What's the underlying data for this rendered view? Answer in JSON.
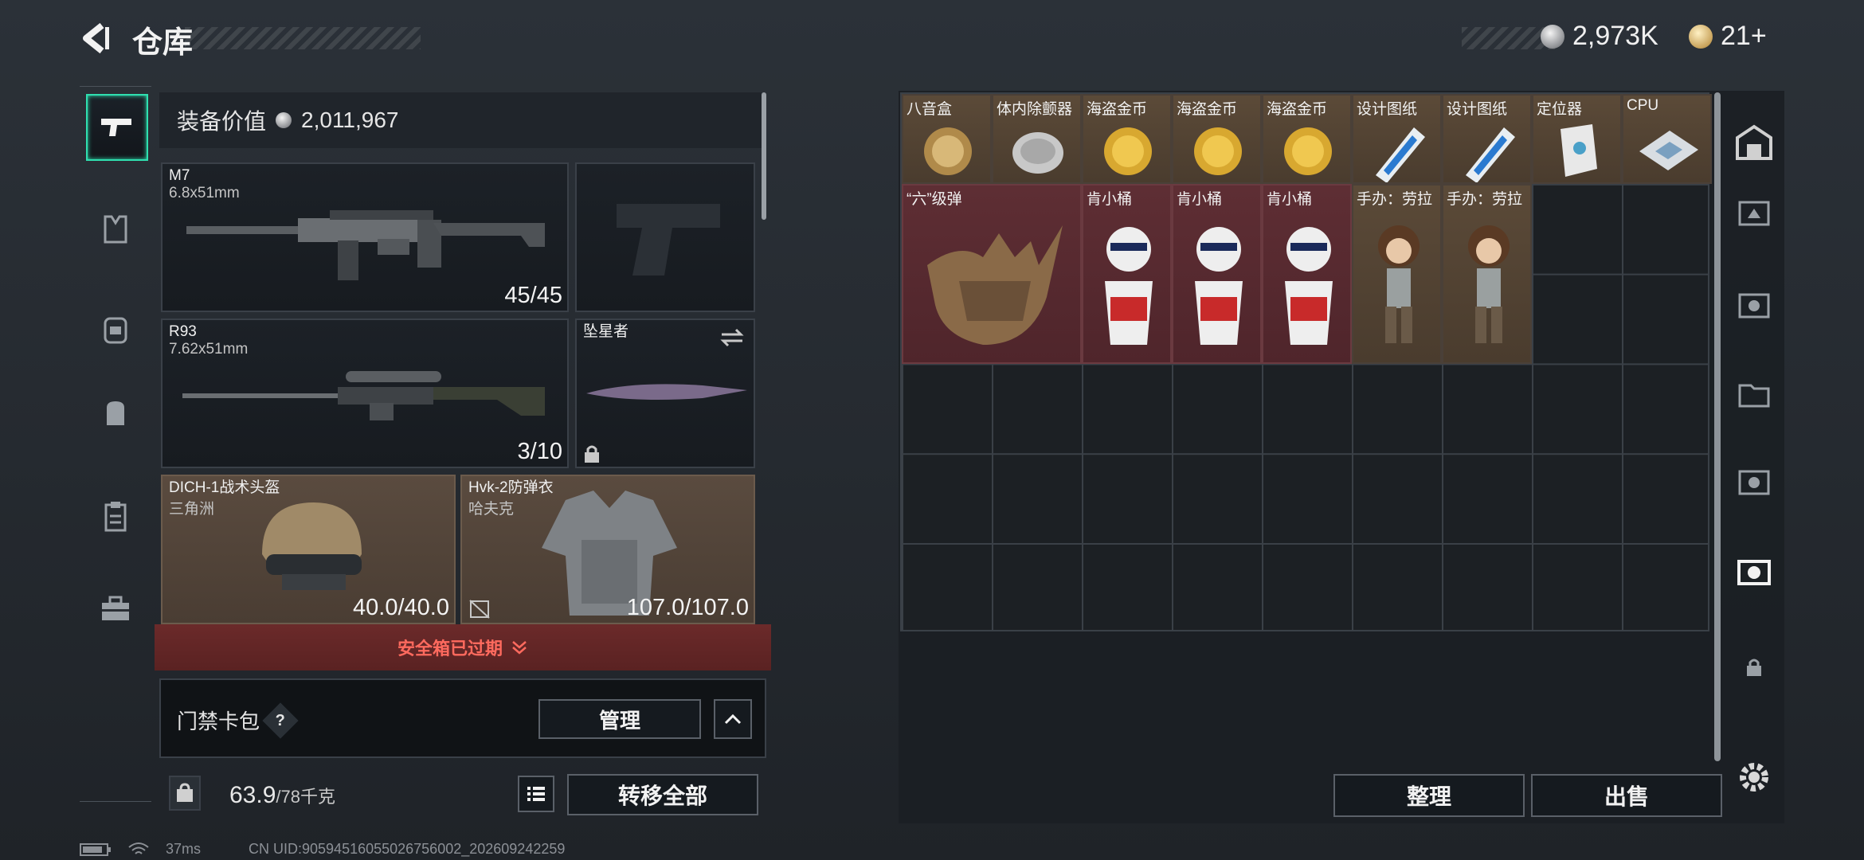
{
  "header": {
    "title": "仓库",
    "currency_silver": "2,973K",
    "currency_gold": "21+"
  },
  "left_nav": {
    "items": [
      "weapon-tab",
      "armor-tab",
      "chest-rig-tab",
      "backpack-tab",
      "clipboard-tab",
      "toolbox-tab"
    ]
  },
  "equipment": {
    "value_label": "装备价值",
    "value": "2,011,967",
    "primary": {
      "name": "M7",
      "caliber": "6.8x51mm",
      "ammo": "45/45"
    },
    "sidearm": {
      "name": ""
    },
    "secondary": {
      "name": "R93",
      "caliber": "7.62x51mm",
      "ammo": "3/10"
    },
    "melee": {
      "name": "坠星者"
    },
    "helmet": {
      "name": "DICH-1战术头盔",
      "sub": "三角洲",
      "durability": "40.0/40.0"
    },
    "armor": {
      "name": "Hvk-2防弹衣",
      "sub": "哈夫克",
      "durability": "107.0/107.0"
    },
    "safe_box": "安全箱已过期",
    "keycard": {
      "label": "门禁卡包",
      "help": "?",
      "manage": "管理"
    },
    "weight": {
      "value": "63.9",
      "max": "/78千克"
    },
    "transfer_all": "转移全部"
  },
  "storage": {
    "row1": [
      "八音盒",
      "体内除颤器",
      "海盗金币",
      "海盗金币",
      "海盗金币",
      "设计图纸",
      "设计图纸",
      "定位器",
      "CPU"
    ],
    "row2": [
      "“六”级弹",
      "肯小桶",
      "肯小桶",
      "肯小桶",
      "手办：劳拉",
      "手办：劳拉"
    ],
    "sort_button": "整理",
    "sell_button": "出售"
  },
  "status_bar": {
    "ping": "37ms",
    "uid": "CN UID:90594516055026756002_202609242259"
  },
  "colors": {
    "accent": "#2fe0b0",
    "gold_rarity": "#5b4a38",
    "red_rarity": "#5e2e34",
    "warning": "#ff6a5e"
  }
}
